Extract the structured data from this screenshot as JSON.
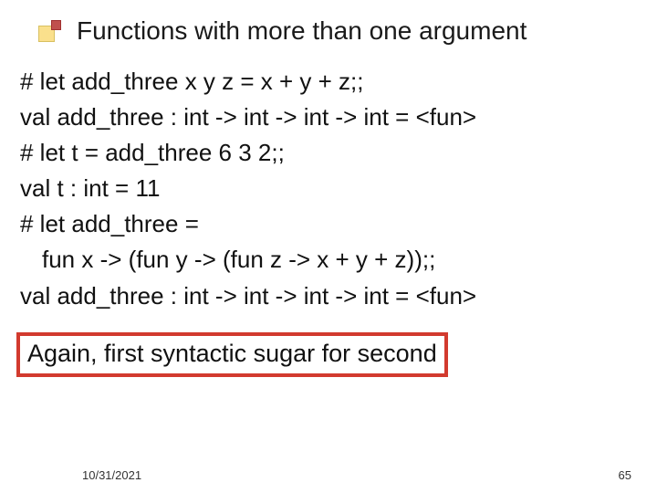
{
  "title": "Functions with more than one argument",
  "code_lines": [
    "# let add_three x y z = x + y + z;;",
    "val add_three : int -> int -> int -> int = <fun>",
    "# let t = add_three 6 3 2;;",
    "val t : int = 11",
    "# let add_three =",
    "fun x -> (fun y -> (fun z -> x + y + z));;",
    "val add_three : int -> int -> int -> int = <fun>"
  ],
  "highlight": "Again, first syntactic sugar for second",
  "footer": {
    "date": "10/31/2021",
    "page": "65"
  },
  "colors": {
    "highlight_border": "#d23a2e",
    "bullet_main": "#fae08c",
    "bullet_accent": "#c0504d"
  }
}
